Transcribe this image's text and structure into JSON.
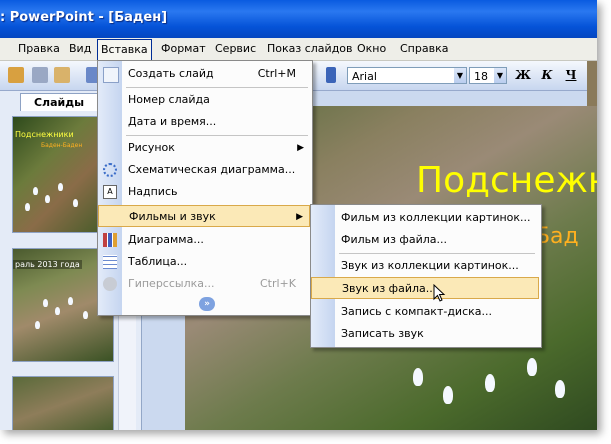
{
  "window": {
    "title": ": PowerPoint - [Баден]"
  },
  "menubar": {
    "items": [
      "Правка",
      "Вид",
      "Вставка",
      "Формат",
      "Сервис",
      "Показ слайдов",
      "Окно",
      "Справка"
    ]
  },
  "toolbar": {
    "font_name": "Arial",
    "font_size": "18",
    "bold": "Ж",
    "italic": "К",
    "underline": "Ч"
  },
  "left_pane": {
    "tab_label": "Слайды",
    "thumb1_title": "Подснежники",
    "thumb1_sub": "Баден-Баден",
    "thumb2_caption": "раль 2013 года"
  },
  "slide": {
    "title": "Подснежн",
    "subtitle": "-Бад"
  },
  "insert_menu": {
    "items": [
      {
        "label": "Создать слайд",
        "shortcut": "Ctrl+M",
        "icon": "new-slide-icon"
      },
      {
        "label": "Номер слайда"
      },
      {
        "label": "Дата и время..."
      },
      {
        "label": "Рисунок",
        "icon": "none"
      },
      {
        "label": "Схематическая диаграмма...",
        "icon": "diagram-icon"
      },
      {
        "label": "Надпись",
        "icon": "textbox-icon"
      },
      {
        "label": "Фильмы и звук",
        "icon": "none"
      },
      {
        "label": "Диаграмма...",
        "icon": "chart-icon"
      },
      {
        "label": "Таблица...",
        "icon": "table-icon"
      },
      {
        "label": "Гиперссылка...",
        "shortcut": "Ctrl+K",
        "icon": "hyperlink-icon",
        "disabled": true
      }
    ]
  },
  "submenu": {
    "items": [
      {
        "label": "Фильм из коллекции картинок..."
      },
      {
        "label": "Фильм из файла..."
      },
      {
        "label": "Звук из коллекции картинок..."
      },
      {
        "label": "Звук из файла..."
      },
      {
        "label": "Запись с компакт-диска..."
      },
      {
        "label": "Записать звук"
      }
    ]
  },
  "colors": {
    "title_bar": "#0a5be0",
    "highlight": "#fbe9b7",
    "slide_title": "#ffff00",
    "slide_subtitle": "#ffb020"
  }
}
